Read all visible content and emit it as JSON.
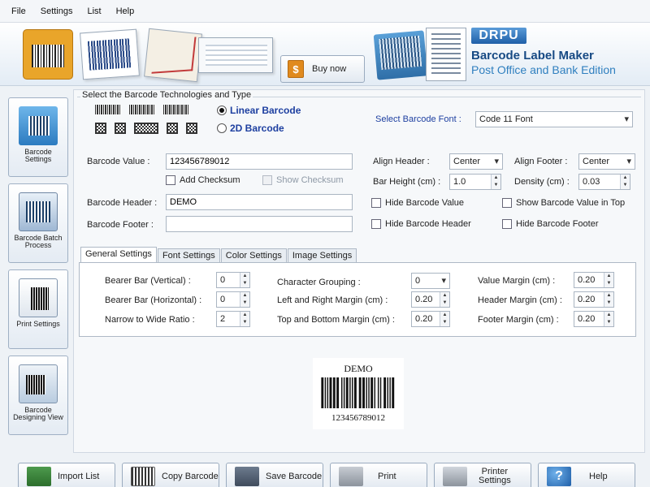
{
  "menu": [
    "File",
    "Settings",
    "List",
    "Help"
  ],
  "banner": {
    "buy_label": "Buy now",
    "buy_icon": "$",
    "brand": "DRPU",
    "product_title": "Barcode Label Maker",
    "product_edition": "Post Office and Bank Edition"
  },
  "sidebar": [
    {
      "label": "Barcode Settings",
      "icon": "barcode-settings-icon"
    },
    {
      "label": "Barcode Batch Process",
      "icon": "batch-process-icon"
    },
    {
      "label": "Print Settings",
      "icon": "print-settings-icon"
    },
    {
      "label": "Barcode Designing View",
      "icon": "designing-view-icon"
    }
  ],
  "technology": {
    "legend": "Select the Barcode Technologies and Type",
    "linear_label": "Linear Barcode",
    "twod_label": "2D Barcode",
    "selected": "linear",
    "font_label": "Select Barcode Font :",
    "font_value": "Code 11 Font"
  },
  "form": {
    "barcode_value_label": "Barcode Value :",
    "barcode_value": "123456789012",
    "add_checksum": "Add Checksum",
    "show_checksum": "Show Checksum",
    "header_label": "Barcode Header :",
    "header_value": "DEMO",
    "footer_label": "Barcode Footer :",
    "footer_value": "",
    "align_header_label": "Align Header   :",
    "align_header_value": "Center",
    "align_footer_label": "Align Footer :",
    "align_footer_value": "Center",
    "bar_height_label": "Bar Height (cm) :",
    "bar_height_value": "1.0",
    "density_label": "Density (cm) :",
    "density_value": "0.03",
    "hide_value": "Hide Barcode Value",
    "show_value_top": "Show Barcode Value in Top",
    "hide_header": "Hide Barcode Header",
    "hide_footer": "Hide Barcode Footer"
  },
  "tabs": [
    "General Settings",
    "Font Settings",
    "Color Settings",
    "Image Settings"
  ],
  "general": {
    "bearer_v_label": "Bearer Bar (Vertical) :",
    "bearer_v_value": "0",
    "bearer_h_label": "Bearer Bar (Horizontal) :",
    "bearer_h_value": "0",
    "ratio_label": "Narrow to Wide Ratio :",
    "ratio_value": "2",
    "grouping_label": "Character Grouping   :",
    "grouping_value": "0",
    "lr_margin_label": "Left and Right Margin (cm) :",
    "lr_margin_value": "0.20",
    "tb_margin_label": "Top and Bottom Margin (cm) :",
    "tb_margin_value": "0.20",
    "value_margin_label": "Value Margin (cm) :",
    "value_margin_value": "0.20",
    "header_margin_label": "Header Margin (cm) :",
    "header_margin_value": "0.20",
    "footer_margin_label": "Footer Margin (cm) :",
    "footer_margin_value": "0.20"
  },
  "preview": {
    "header": "DEMO",
    "value": "123456789012"
  },
  "buttons": {
    "import": "Import List",
    "copy": "Copy Barcode",
    "save": "Save Barcode",
    "print": "Print",
    "printer_settings_1": "Printer",
    "printer_settings_2": "Settings",
    "help": "Help",
    "help_icon": "?"
  }
}
